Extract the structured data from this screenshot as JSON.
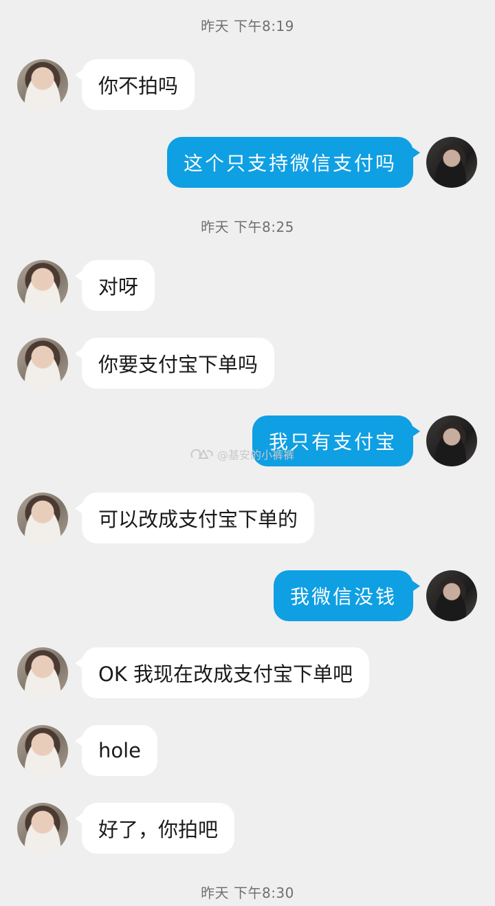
{
  "timestamps": [
    "昨天 下午8:19",
    "昨天 下午8:25",
    "昨天 下午8:30"
  ],
  "messages": [
    {
      "side": "left",
      "text": "你不拍吗"
    },
    {
      "side": "right",
      "text": "这个只支持微信支付吗"
    },
    {
      "side": "left",
      "text": "对呀"
    },
    {
      "side": "left",
      "text": "你要支付宝下单吗"
    },
    {
      "side": "right",
      "text": "我只有支付宝"
    },
    {
      "side": "left",
      "text": "可以改成支付宝下单的"
    },
    {
      "side": "right",
      "text": "我微信没钱"
    },
    {
      "side": "left",
      "text": "OK 我现在改成支付宝下单吧"
    },
    {
      "side": "left",
      "text": "hole"
    },
    {
      "side": "left",
      "text": "好了，你拍吧"
    }
  ],
  "watermark": {
    "text": "@基安的小裤裤",
    "icon": "weibo-logo-icon"
  },
  "colors": {
    "background": "#efefef",
    "sent_bubble": "#0f9fe3",
    "received_bubble": "#ffffff"
  }
}
